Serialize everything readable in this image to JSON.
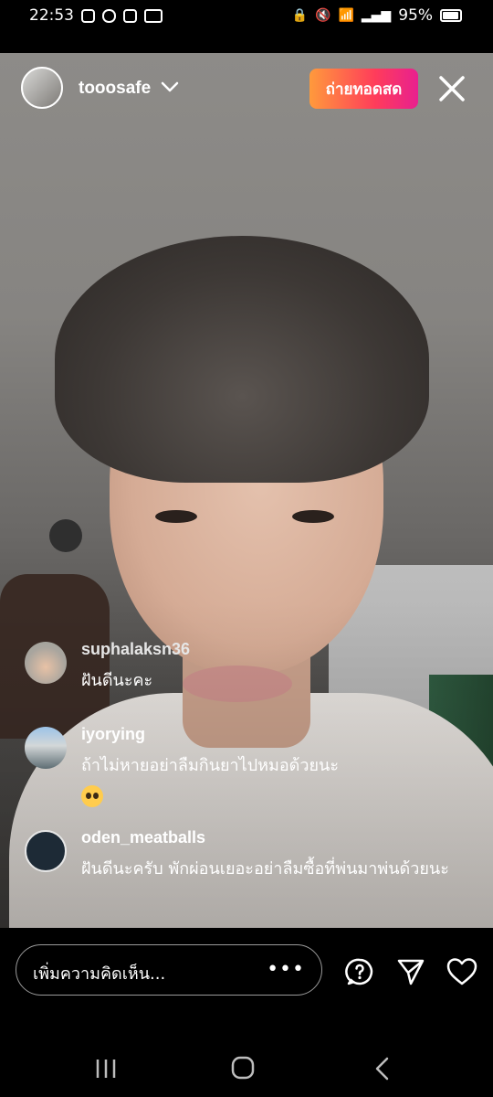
{
  "status_bar": {
    "time": "22:53",
    "battery": "95%",
    "icons": [
      "notification-icon",
      "line-icon",
      "notification-icon",
      "video-icon",
      "lock-icon",
      "mute-icon",
      "wifi-icon",
      "signal-icon"
    ]
  },
  "live": {
    "host_name": "tooosafe",
    "go_live_label": "ถ่ายทอดสด"
  },
  "comments": [
    {
      "user": "suphalaksn36",
      "text": "ฝันดีนะคะ"
    },
    {
      "user": "iyorying",
      "text": "ถ้าไม่หายอย่าลืมกินยาไปหมอด้วยนะ",
      "emoji": "pleading-face"
    },
    {
      "user": "oden_meatballs",
      "text": "ฝันดีนะครับ พักผ่อนเยอะอย่าลืมซื้อที่พ่นมาพ่นด้วยนะ"
    }
  ],
  "input": {
    "placeholder": "เพิ่มความคิดเห็น...",
    "more_label": "•••"
  },
  "colors": {
    "go_live_gradient": [
      "#ff9a3c",
      "#ff3d5a",
      "#e8208f"
    ],
    "background": "#000000"
  }
}
